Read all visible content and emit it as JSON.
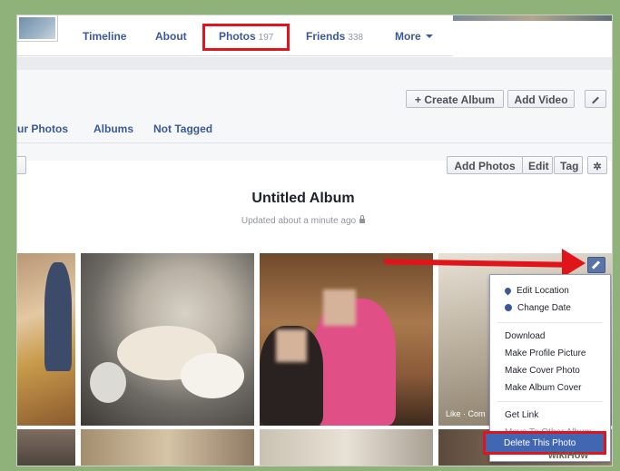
{
  "nav": {
    "tabs": [
      {
        "label": "Timeline",
        "count": ""
      },
      {
        "label": "About",
        "count": ""
      },
      {
        "label": "Photos",
        "count": "197"
      },
      {
        "label": "Friends",
        "count": "338"
      },
      {
        "label": "More",
        "count": ""
      }
    ]
  },
  "toolbar": {
    "create_album": "+ Create Album",
    "add_video": "Add Video"
  },
  "subtabs": [
    "ur Photos",
    "Albums",
    "Not Tagged"
  ],
  "album_actions": {
    "add_photos": "Add Photos",
    "edit": "Edit",
    "tag": "Tag"
  },
  "album": {
    "title": "Untitled Album",
    "updated": "Updated about a minute ago"
  },
  "photo_caption": "Like · Com",
  "menu": {
    "edit_location": "Edit Location",
    "change_date": "Change Date",
    "download": "Download",
    "make_profile_picture": "Make Profile Picture",
    "make_cover_photo": "Make Cover Photo",
    "make_album_cover": "Make Album Cover",
    "get_link": "Get Link",
    "move_to_other_album": "Move To Other Album",
    "delete_this_photo": "Delete This Photo"
  },
  "watermark": "wikiHow",
  "colors": {
    "brand": "#3b5998",
    "highlight_red": "#e0141b",
    "menu_selected": "#4267b2"
  }
}
